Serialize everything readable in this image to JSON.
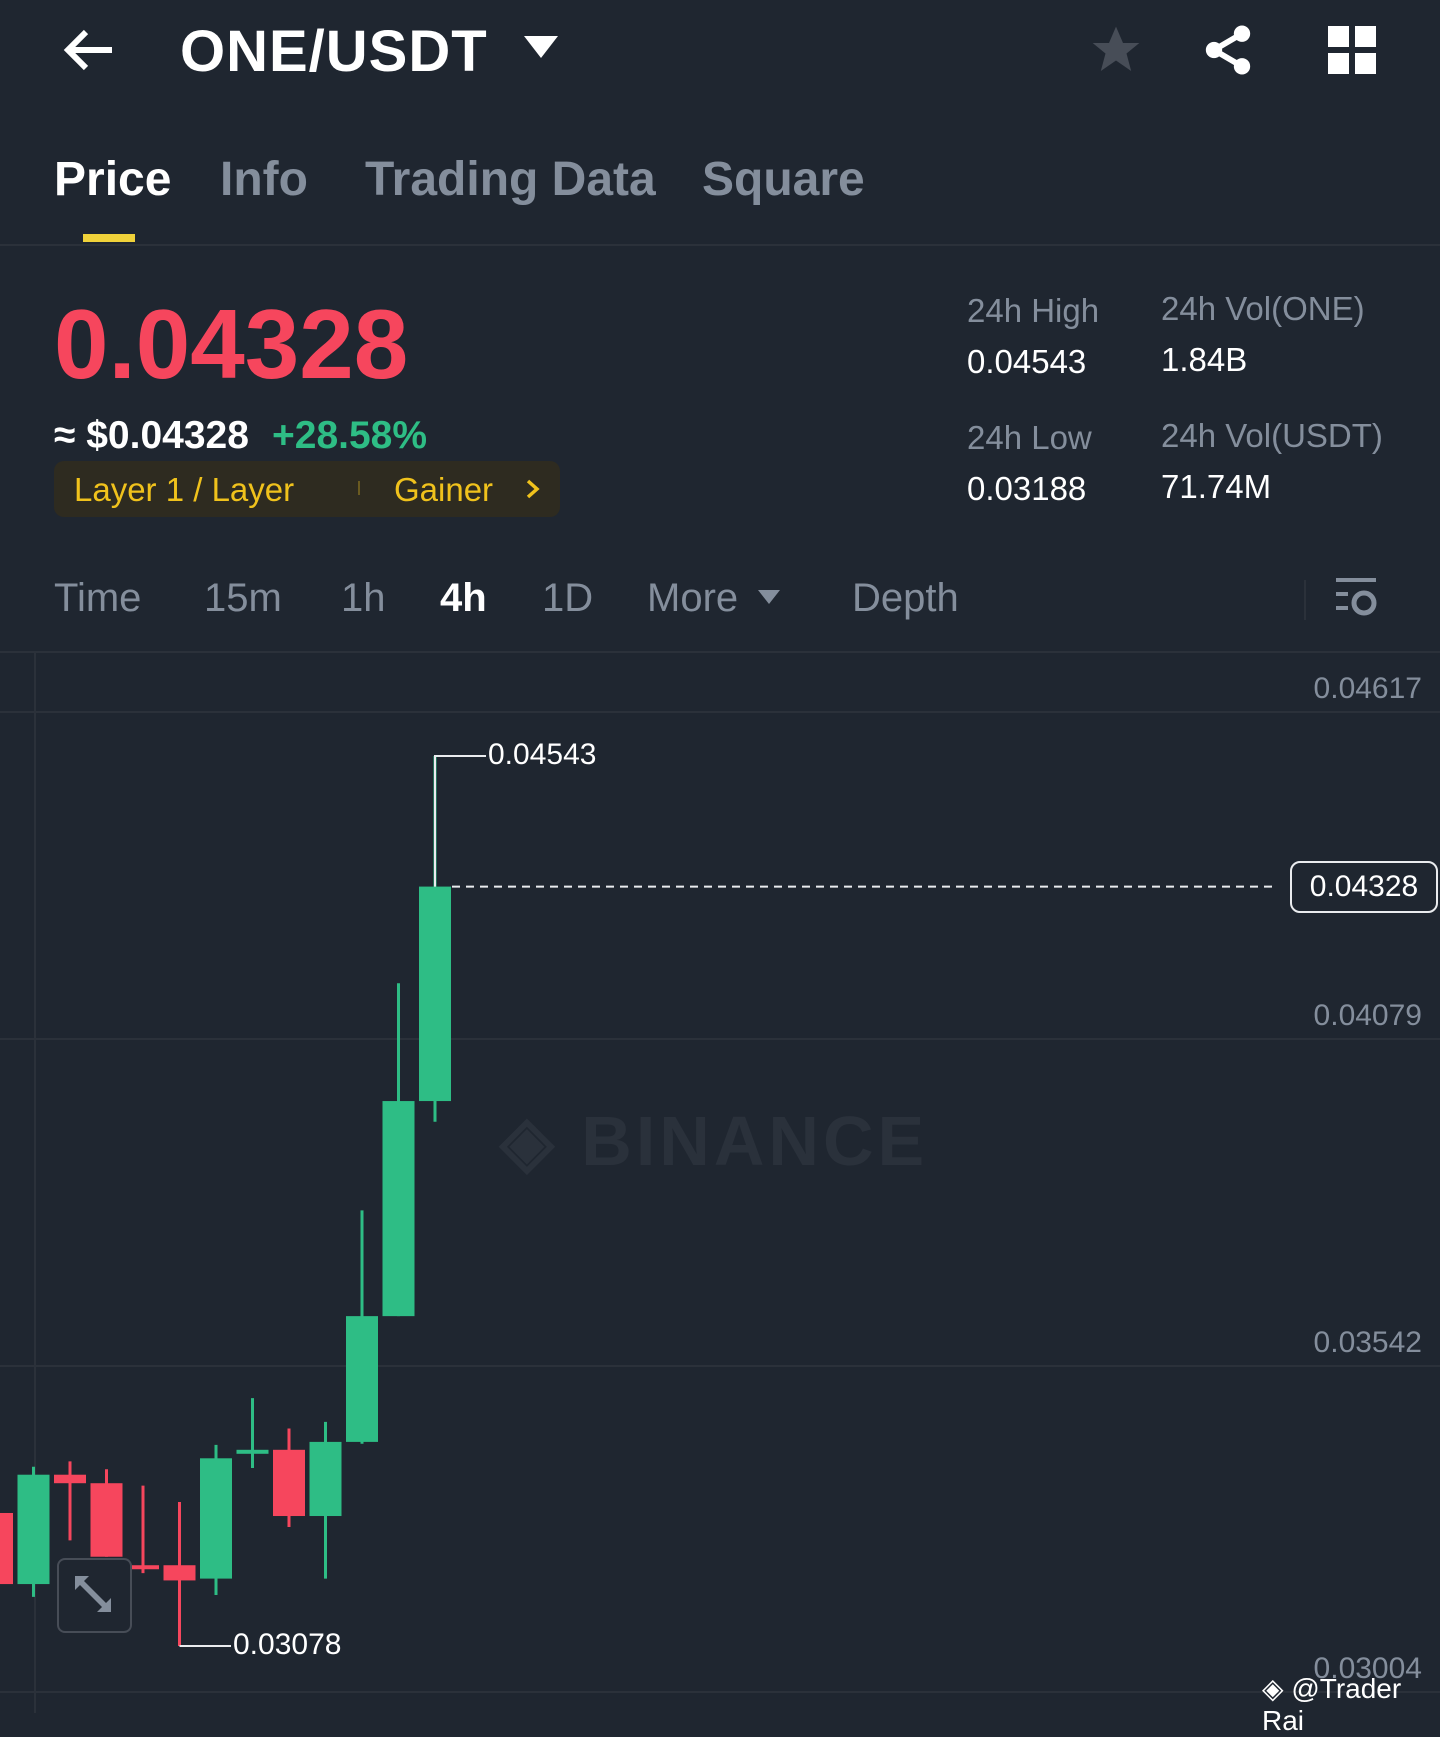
{
  "header": {
    "title": "ONE/USDT",
    "back_icon": "arrow-left-icon",
    "star_icon": "star-icon",
    "share_icon": "share-icon",
    "grid_icon": "grid-icon"
  },
  "tabs": [
    {
      "label": "Price"
    },
    {
      "label": "Info"
    },
    {
      "label": "Trading Data"
    },
    {
      "label": "Square"
    }
  ],
  "price": {
    "last": "0.04328",
    "usd": "≈ $0.04328",
    "change": "+28.58%",
    "badge_left": "Layer 1 / Layer",
    "badge_right": "Gainer"
  },
  "stats": {
    "high_label": "24h High",
    "high": "0.04543",
    "low_label": "24h Low",
    "low": "0.03188",
    "vol_one_label": "24h Vol(ONE)",
    "vol_one": "1.84B",
    "vol_usdt_label": "24h Vol(USDT)",
    "vol_usdt": "71.74M"
  },
  "intervals": [
    {
      "label": "Time"
    },
    {
      "label": "15m"
    },
    {
      "label": "1h"
    },
    {
      "label": "4h"
    },
    {
      "label": "1D"
    },
    {
      "label": "More"
    },
    {
      "label": "Depth"
    }
  ],
  "colors": {
    "up": "#2ebd85",
    "down": "#f6465d",
    "accent": "#f0d23a"
  },
  "chart_data": {
    "type": "candlestick",
    "interval": "4h",
    "y_ticks": [
      "0.04617",
      "0.04079",
      "0.03542",
      "0.03004"
    ],
    "ylim": [
      0.03004,
      0.04617
    ],
    "current_price": "0.04328",
    "high_marker": "0.04543",
    "low_marker": "0.03078",
    "watermark": "BINANCE",
    "candles": [
      {
        "o": 0.03297,
        "h": 0.0331,
        "l": 0.0317,
        "c": 0.0318
      },
      {
        "o": 0.0318,
        "h": 0.03373,
        "l": 0.03159,
        "c": 0.0336
      },
      {
        "o": 0.0336,
        "h": 0.03382,
        "l": 0.03252,
        "c": 0.03346
      },
      {
        "o": 0.03346,
        "h": 0.03369,
        "l": 0.03225,
        "c": 0.03225
      },
      {
        "o": 0.03211,
        "h": 0.03342,
        "l": 0.03198,
        "c": 0.03206
      },
      {
        "o": 0.03211,
        "h": 0.03315,
        "l": 0.03078,
        "c": 0.03186
      },
      {
        "o": 0.03189,
        "h": 0.03409,
        "l": 0.03162,
        "c": 0.03387
      },
      {
        "o": 0.03396,
        "h": 0.03486,
        "l": 0.03371,
        "c": 0.03401
      },
      {
        "o": 0.03401,
        "h": 0.03436,
        "l": 0.03274,
        "c": 0.03292
      },
      {
        "o": 0.03292,
        "h": 0.03447,
        "l": 0.03189,
        "c": 0.03414
      },
      {
        "o": 0.03414,
        "h": 0.03795,
        "l": 0.03411,
        "c": 0.03621
      },
      {
        "o": 0.03621,
        "h": 0.04169,
        "l": 0.03621,
        "c": 0.03975
      },
      {
        "o": 0.03975,
        "h": 0.04543,
        "l": 0.03941,
        "c": 0.04328
      }
    ]
  },
  "credit": "@Trader Rai"
}
